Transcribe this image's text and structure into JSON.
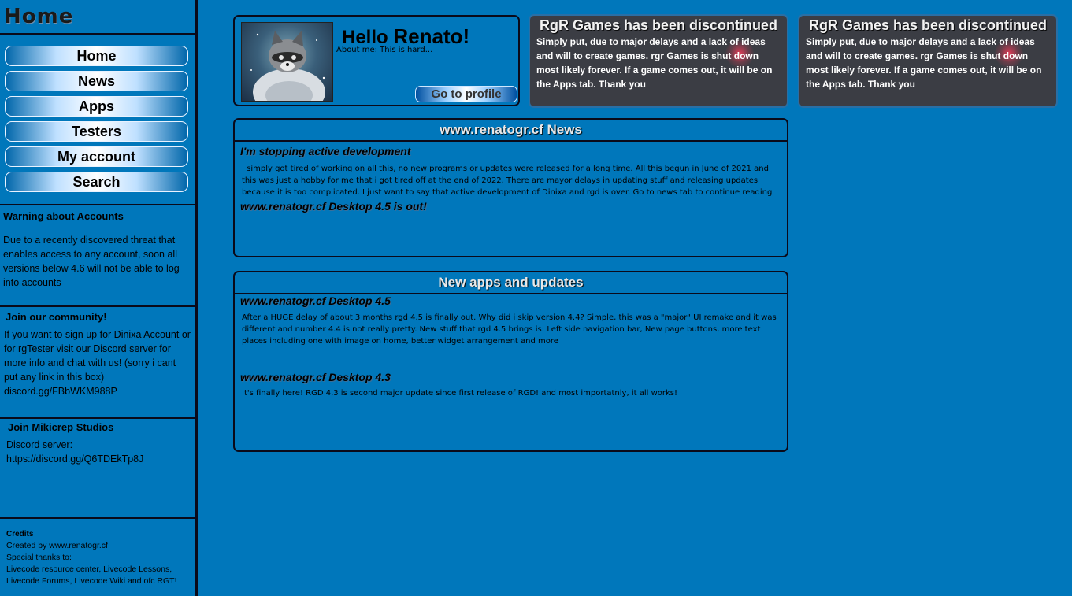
{
  "sidebar": {
    "title": "Home",
    "nav": [
      "Home",
      "News",
      "Apps",
      "Testers",
      "My account",
      "Search"
    ],
    "warning": {
      "title": "Warning about Accounts",
      "body": "Due to a recently discovered threat that enables access to any account, soon all versions below 4.6 will not be able to log into accounts"
    },
    "community": {
      "title": "Join our community!",
      "body": "If you want to sign up for Dinixa Account or for rgTester visit our Discord server for more info and chat with us! (sorry i cant put any link in this box)",
      "link": "discord.gg/FBbWKM988P"
    },
    "mikicrep": {
      "title": "Join Mikicrep Studios",
      "label": "Discord server:",
      "link": "https://discord.gg/Q6TDEkTp8J"
    },
    "credits": {
      "title": "Credits",
      "line1": "Created by www.renatogr.cf",
      "line2": "Special thanks to:",
      "line3": "Livecode resource center, Livecode Lessons,",
      "line4": "Livecode Forums, Livecode Wiki and ofc RGT!"
    }
  },
  "profile": {
    "greeting": "Hello",
    "name": "Renato!",
    "about": "About me: This is hard...",
    "button": "Go to profile"
  },
  "announcements": [
    {
      "title": "RgR Games has been discontinued",
      "body": "Simply put, due to major delays and a lack of ideas and will to create games. rgr Games is shut down most likely forever. If a game comes out, it will be on the Apps tab. Thank you"
    },
    {
      "title": "RgR Games has been discontinued",
      "body": "Simply put, due to major delays and a lack of ideas and will to create games. rgr Games is shut down most likely forever. If a game comes out, it will be on the Apps tab. Thank you"
    }
  ],
  "news": {
    "title": "www.renatogr.cf News",
    "items": [
      {
        "title": "I'm stopping active development",
        "body": "I simply got tired of working on all this, no new programs or updates were released for a long time. All this begun in June of 2021 and this was just a hobby for me that i got tired off at the end of 2022. There are mayor delays in updating stuff and releasing updates because it is too complicated. I just want to say that active development of Dinixa and rgd is over. Go to news tab to continue reading"
      },
      {
        "title": "www.renatogr.cf Desktop 4.5 is out!",
        "body": ""
      }
    ]
  },
  "apps": {
    "title": "New apps and updates",
    "items": [
      {
        "title": "www.renatogr.cf Desktop 4.5",
        "body": "After a HUGE delay of about 3 months rgd 4.5 is finally out. Why did i skip version 4.4? Simple, this was a \"major\" UI remake and it was different and number 4.4 is not really pretty. New stuff that rgd 4.5 brings is: Left side navigation bar, New page buttons, more text places including one with image on home, better widget arrangement and more"
      },
      {
        "title": "www.renatogr.cf Desktop 4.3",
        "body": "It's finally here! RGD 4.3 is second major update since first release of RGD! and most importatnly, it all works!"
      }
    ]
  }
}
